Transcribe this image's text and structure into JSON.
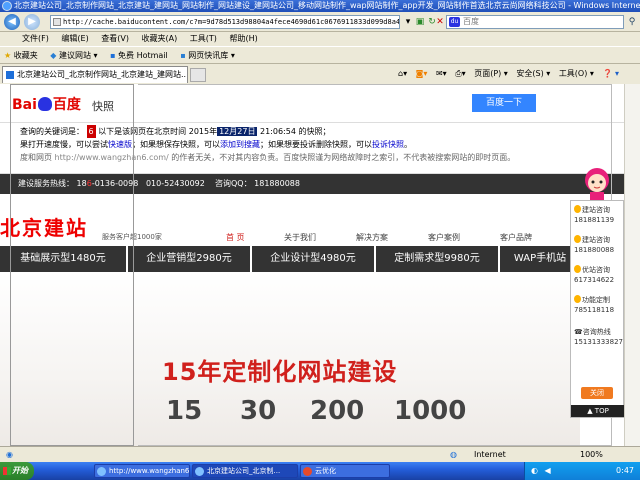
{
  "window": {
    "title": "北京建站公司_北京制作网站_北京建站_建网站_网站制作_网站建设_建网站公司_移动网站制作_wap网站制作_app开发_网站制作首选北京云尚网络科技公司 - Windows Internet Explorer"
  },
  "address_bar": {
    "url": "http://cache.baiducontent.com/c?m=9d78d513d98804a4fece4690d61c0676911833d099d8a4823c3",
    "search_placeholder": "百度",
    "search_provider": "百度"
  },
  "menu": [
    "文件(F)",
    "编辑(E)",
    "查看(V)",
    "收藏夹(A)",
    "工具(T)",
    "帮助(H)"
  ],
  "favorites_bar": {
    "label": "收藏夹",
    "items": [
      "建议网站 ▾",
      "免费 Hotmail",
      "网页快讯库 ▾"
    ]
  },
  "tab": {
    "title": "北京建站公司_北京制作网站_北京建站_建网站..."
  },
  "command_bar": {
    "page": "页面(P) ▾",
    "safety": "安全(S) ▾",
    "tools": "工具(O) ▾",
    "help": "❓ ▾"
  },
  "baidu": {
    "logo_left": "Bai",
    "logo_right": "百度",
    "snapshot_label": "快照",
    "search_button": "百度一下",
    "note_line1_pre": "查询的关键词是：",
    "keyword": "6",
    "note_line1_mid": "以下是该网页在北京时间 2015年",
    "note_date": "12月27日",
    "note_line1_post": "21:06:54 的快照；",
    "note_line2_pre": "果打开速度慢，可以尝试",
    "link_fast": "快速版",
    "note_line2_mid": "；如果想保存快照，可以",
    "link_add": "添加到搜藏",
    "note_line2_mid2": "；如果想要投诉删除快照，可以",
    "link_complain": "投诉快照",
    "note_line2_post": "。",
    "note_line3_pre": "度和网页",
    "link_site": "http://www.wangzhan6.com/",
    "note_line3_post": "的作者无关，不对其内容负责。百度快照谨为网络故障时之索引，不代表被搜索网站的即时页面。"
  },
  "site": {
    "hotline_label": "建设服务热线：",
    "hotline_phone1_a": "18",
    "hotline_phone1_hl": "6",
    "hotline_phone1_b": "-0136-0098",
    "hotline_phone2": "010-52430092",
    "qq_label": "咨询QQ：",
    "qq_number": "181880088",
    "logo": "北京建站",
    "tel_line": "服务客户超1000家",
    "nav": [
      "首 页",
      "关于我们",
      "解决方案",
      "客户案例",
      "客户品牌"
    ],
    "tabs": [
      "基础展示型1480元",
      "企业营销型2980元",
      "企业设计型4980元",
      "定制需求型9980元",
      "WAP手机站"
    ],
    "headline": "15年定制化网站建设",
    "stats": [
      "15",
      "30",
      "200",
      "1000"
    ]
  },
  "qq_widget": {
    "items": [
      {
        "label": "建站咨询",
        "number": "181881139"
      },
      {
        "label": "建站咨询",
        "number": "181880088"
      },
      {
        "label": "优站咨询",
        "number": "617314622"
      },
      {
        "label": "功能定制",
        "number": "785118118"
      }
    ],
    "hotline_label": "咨询热线",
    "hotline_number": "15131333827",
    "close": "关闭",
    "top": "▲ TOP"
  },
  "status_bar": {
    "zone": "Internet",
    "zoom": "100%"
  },
  "taskbar": {
    "start": "开始",
    "tasks": [
      "http://www.wangzhan6.com_...",
      "北京建站公司_北京制...",
      "云优化"
    ],
    "time": "0:47"
  }
}
